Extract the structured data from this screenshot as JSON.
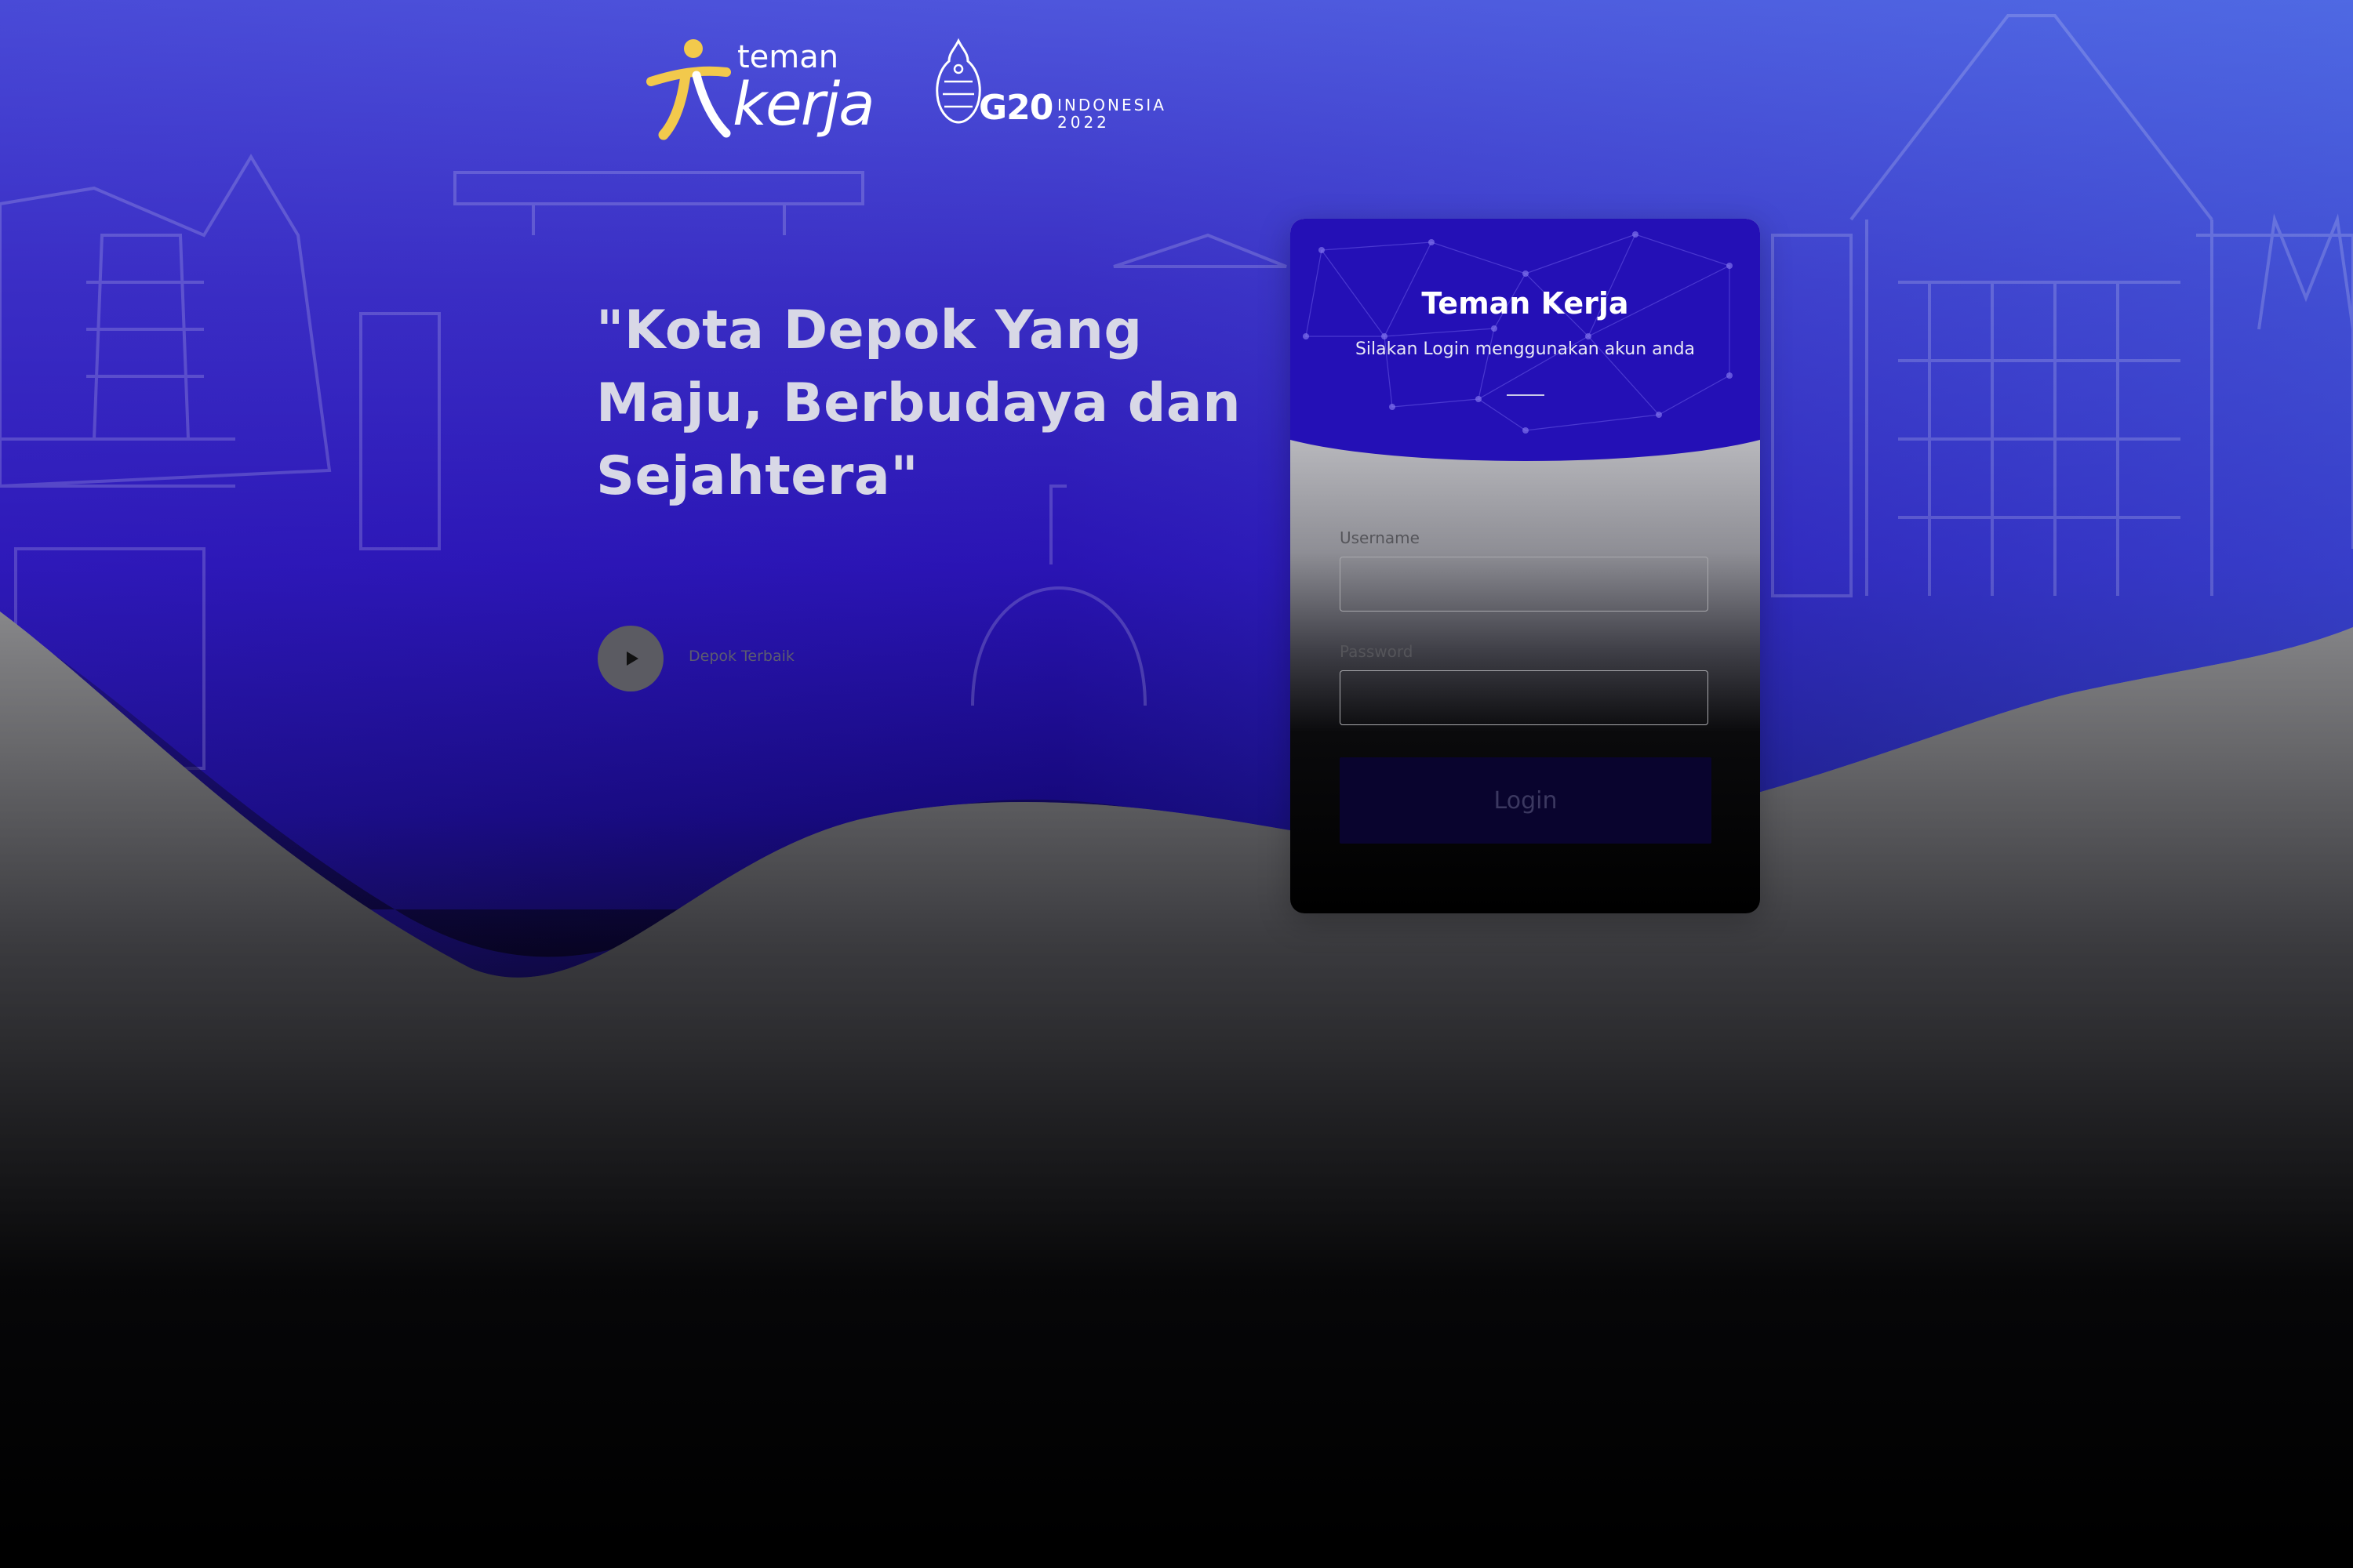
{
  "logos": {
    "app_logo_top": "teman",
    "app_logo_bottom": "kerja",
    "g20_main": "G20",
    "g20_country": "INDONESIA",
    "g20_year": "2022"
  },
  "hero": {
    "line1": "\"Kota Depok Yang",
    "line2": "Maju, Berbudaya dan",
    "line3": "Sejahtera\""
  },
  "video": {
    "label": "Depok Terbaik"
  },
  "login_card": {
    "title": "Teman Kerja",
    "subtitle": "Silakan Login menggunakan akun anda",
    "username_label": "Username",
    "username_value": "",
    "password_label": "Password",
    "password_value": "",
    "login_button": "Login"
  },
  "colors": {
    "brand_primary": "#2a14b4",
    "logo_accent": "#f2c94c",
    "button_bg": "#09042e"
  },
  "icons": {
    "play": "play-icon",
    "app_logo_mark": "teman-kerja-figure-icon",
    "g20_mark": "g20-emblem-icon"
  }
}
